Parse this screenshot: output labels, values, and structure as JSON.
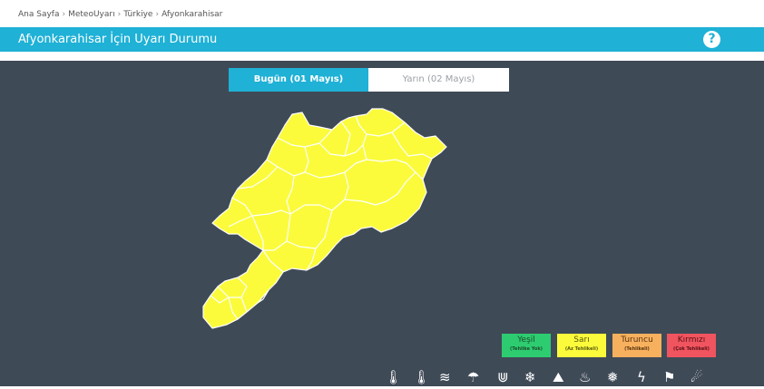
{
  "breadcrumb": [
    "Ana Sayfa",
    "MeteoUyarı",
    "Türkiye",
    "Afyonkarahisar"
  ],
  "header": {
    "title": "Afyonkarahisar İçin Uyarı Durumu",
    "help": "?"
  },
  "tabs": [
    {
      "label": "Bugün (01 Mayıs)",
      "active": true
    },
    {
      "label": "Yarın (02 Mayıs)",
      "active": false
    }
  ],
  "map": {
    "fill": "#fbfb3c",
    "border": "#ffffff",
    "level": "Sarı"
  },
  "legend": [
    {
      "name": "Yeşil",
      "desc": "(Tehlike Yok)",
      "color": "#2ecc71",
      "text": "#1b4d2b"
    },
    {
      "name": "Sarı",
      "desc": "(Az Tehlikeli)",
      "color": "#fbfb3c",
      "text": "#5a5a10"
    },
    {
      "name": "Turuncu",
      "desc": "(Tehlikeli)",
      "color": "#f7b05e",
      "text": "#5a3510"
    },
    {
      "name": "Kırmızı",
      "desc": "(Çok Tehlikeli)",
      "color": "#f0545f",
      "text": "#5a1015"
    }
  ],
  "icons": [
    "thermometer-low-icon",
    "thermometer-high-icon",
    "waves-icon",
    "thunderstorm-icon",
    "icicles-icon",
    "snow-icon",
    "avalanche-icon",
    "forest-fire-icon",
    "snowflake-icon",
    "lightning-icon",
    "wind-flag-icon",
    "weather-misc-icon"
  ]
}
